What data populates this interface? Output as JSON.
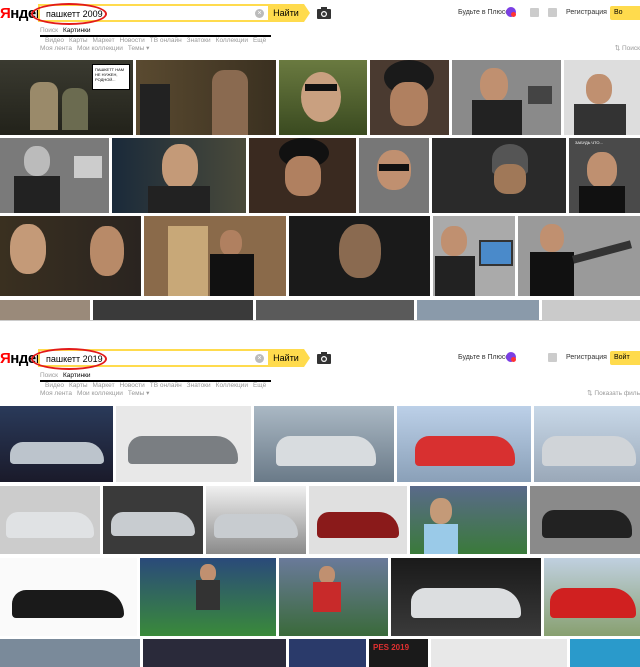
{
  "logo": "Яндекс",
  "header": {
    "find_label": "Найти",
    "plus_label": "Будьте в Плюсе",
    "register_label": "Регистрация",
    "signin_label_1": "Во",
    "signin_label_2": "Войт"
  },
  "search1": {
    "value": "пашкетт 2009"
  },
  "search2": {
    "value": "пашкетт 2019"
  },
  "tabs": [
    "Поиск",
    "Картинки",
    "Видео",
    "Карты",
    "Маркет",
    "Новости",
    "ТВ онлайн",
    "Знатоки",
    "Коллекции",
    "Ещё"
  ],
  "subnav": {
    "feed": "Моя лента",
    "collections": "Мои коллекции",
    "topics": "Темы ▾"
  },
  "filters_label_1": "Поиск",
  "filters_label_2": "Показать филь",
  "thumb_caption": "ПАШКЕТТ НАМ НЕ НУЖЕН, РОДНОЙ...",
  "thumb_caption_2": "ЗАБУДЬ ЧТО...",
  "thumb_caption_3": "PES 2019",
  "colors": {
    "accent": "#ffdb4d",
    "highlight": "#e21a1a"
  }
}
